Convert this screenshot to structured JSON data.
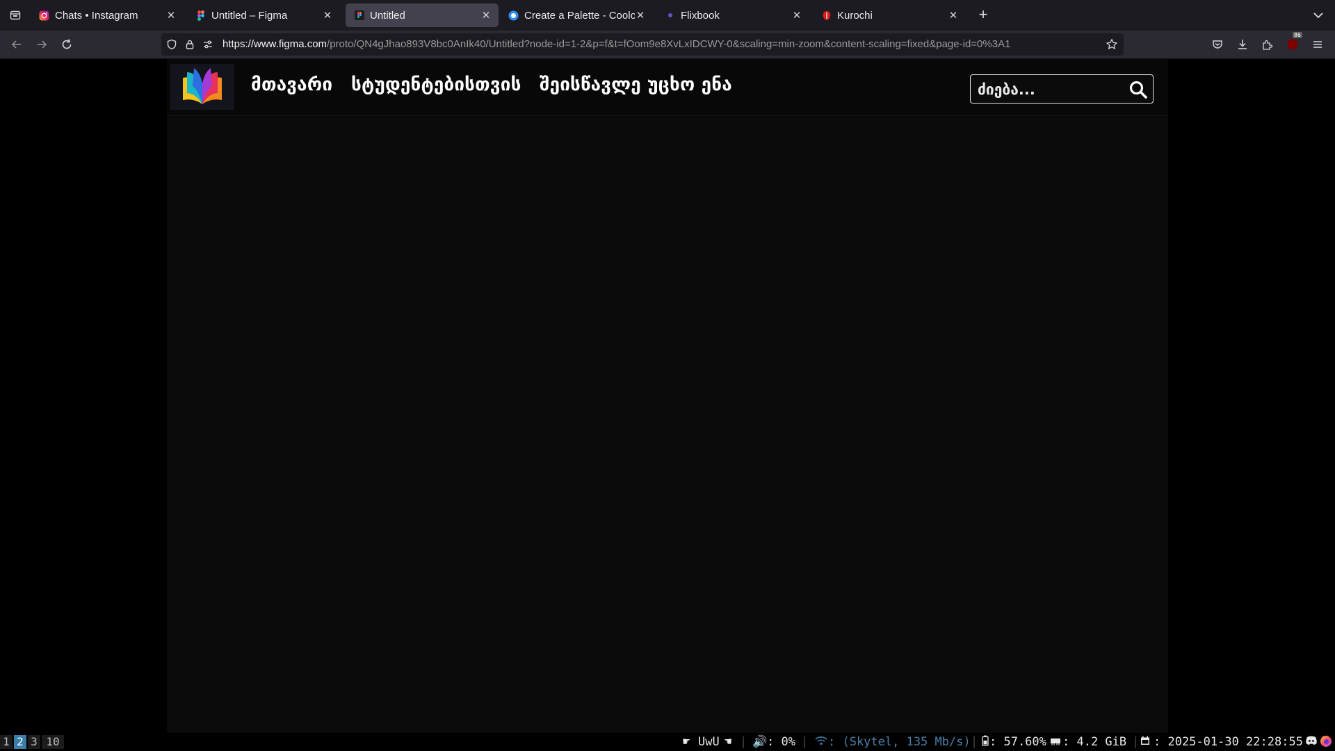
{
  "browser": {
    "tabs": [
      {
        "title": "Chats • Instagram",
        "favicon": "instagram-icon",
        "active": false
      },
      {
        "title": "Untitled – Figma",
        "favicon": "figma-icon",
        "active": false
      },
      {
        "title": "Untitled",
        "favicon": "figma-icon",
        "active": true
      },
      {
        "title": "Create a Palette - Coolors",
        "favicon": "coolors-icon",
        "active": false
      },
      {
        "title": "Flixbook",
        "favicon": "flixbook-icon",
        "active": false
      },
      {
        "title": "Kurochi",
        "favicon": "kurochi-icon",
        "active": false
      }
    ],
    "url_host": "https://www.figma.com",
    "url_rest": "/proto/QN4gJhao893V8bc0AnIk40/Untitled?node-id=1-2&p=f&t=fOom9e8XvLxIDCWY-0&scaling=min-zoom&content-scaling=fixed&page-id=0%3A1",
    "extension_badge": "86"
  },
  "site": {
    "nav": {
      "home": "მთავარი",
      "students": "სტუდენტებისთვის",
      "learn": "შეისწავლე უცხო ენა"
    },
    "search": {
      "placeholder": "ძიება..."
    }
  },
  "statusbar": {
    "workspaces": [
      "1",
      "2",
      "3",
      "10"
    ],
    "active_workspace": "2",
    "title": "UwU",
    "volume": ": 0%",
    "wifi": ": (Skytel, 135 Mb/s)",
    "battery": ": 57.60%",
    "memory": ": 4.2 GiB",
    "datetime": ": 2025-01-30 22:28:55"
  },
  "colors": {
    "tabstrip_bg": "#1c1b22",
    "navbar_bg": "#2b2a33",
    "active_tab_bg": "#42414d",
    "page_bg": "#0a0a0a",
    "active_workspace": "#3a7ea8"
  }
}
